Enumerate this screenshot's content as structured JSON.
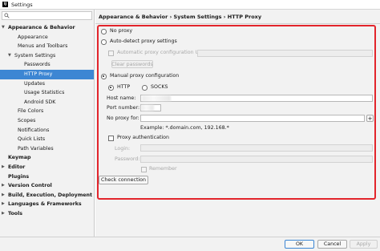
{
  "window": {
    "title": "Settings",
    "icon_text": "IJ"
  },
  "breadcrumb": "Appearance & Behavior › System Settings › HTTP Proxy",
  "sidebar": {
    "search_placeholder": "",
    "items": [
      {
        "label": "Appearance & Behavior",
        "level": 0,
        "arrow": "▼",
        "bold": true
      },
      {
        "label": "Appearance",
        "level": 2,
        "arrow": ""
      },
      {
        "label": "Menus and Toolbars",
        "level": 2,
        "arrow": ""
      },
      {
        "label": "System Settings",
        "level": 1,
        "arrow": "▼"
      },
      {
        "label": "Passwords",
        "level": 3,
        "arrow": ""
      },
      {
        "label": "HTTP Proxy",
        "level": 3,
        "arrow": "",
        "selected": true
      },
      {
        "label": "Updates",
        "level": 3,
        "arrow": ""
      },
      {
        "label": "Usage Statistics",
        "level": 3,
        "arrow": ""
      },
      {
        "label": "Android SDK",
        "level": 3,
        "arrow": ""
      },
      {
        "label": "File Colors",
        "level": 2,
        "arrow": ""
      },
      {
        "label": "Scopes",
        "level": 2,
        "arrow": ""
      },
      {
        "label": "Notifications",
        "level": 2,
        "arrow": ""
      },
      {
        "label": "Quick Lists",
        "level": 2,
        "arrow": ""
      },
      {
        "label": "Path Variables",
        "level": 2,
        "arrow": ""
      },
      {
        "label": "Keymap",
        "level": 0,
        "arrow": "",
        "bold": true
      },
      {
        "label": "Editor",
        "level": 0,
        "arrow": "▶",
        "bold": true
      },
      {
        "label": "Plugins",
        "level": 0,
        "arrow": "",
        "bold": true
      },
      {
        "label": "Version Control",
        "level": 0,
        "arrow": "▶",
        "bold": true
      },
      {
        "label": "Build, Execution, Deployment",
        "level": 0,
        "arrow": "▶",
        "bold": true
      },
      {
        "label": "Languages & Frameworks",
        "level": 0,
        "arrow": "▶",
        "bold": true
      },
      {
        "label": "Tools",
        "level": 0,
        "arrow": "▶",
        "bold": true
      }
    ]
  },
  "proxy": {
    "no_proxy": "No proxy",
    "auto_detect": "Auto-detect proxy settings",
    "auto_config_url": "Automatic proxy configuration URL:",
    "clear_passwords": "Clear passwords",
    "manual": "Manual proxy configuration",
    "http": "HTTP",
    "socks": "SOCKS",
    "host_name": "Host name:",
    "port_number": "Port number:",
    "no_proxy_for": "No proxy for:",
    "example": "Example: *.domain.com, 192.168.*",
    "proxy_auth": "Proxy authentication",
    "login": "Login:",
    "password": "Password:",
    "remember": "Remember",
    "check_connection": "Check connection",
    "selected_mode": "manual",
    "selected_type": "http"
  },
  "footer": {
    "ok": "OK",
    "cancel": "Cancel",
    "apply": "Apply"
  },
  "colors": {
    "selection": "#3d86d3",
    "highlight_border": "#e2252c"
  }
}
